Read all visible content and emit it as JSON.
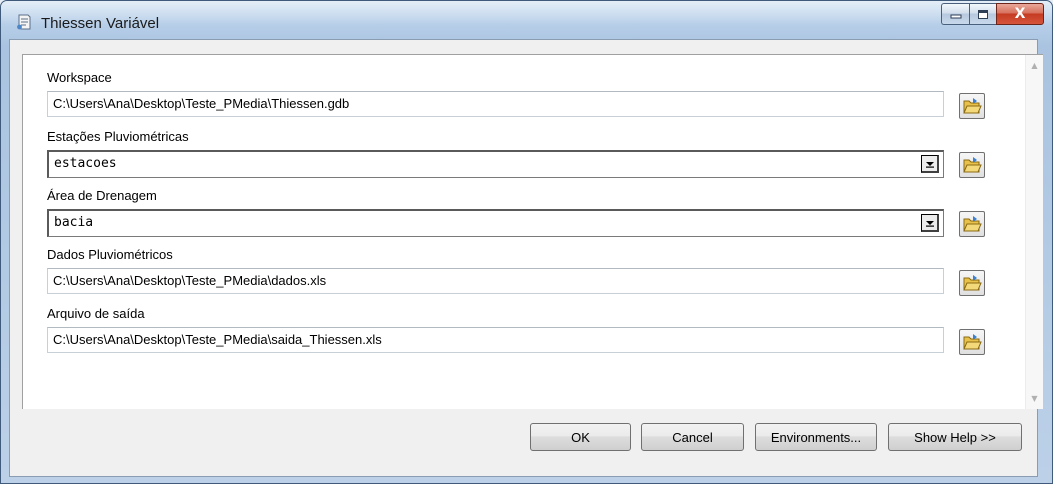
{
  "window": {
    "title": "Thiessen Variável",
    "close_label": "X"
  },
  "fields": {
    "workspace": {
      "label": "Workspace",
      "value": "C:\\Users\\Ana\\Desktop\\Teste_PMedia\\Thiessen.gdb"
    },
    "stations": {
      "label": "Estações Pluviométricas",
      "value": "estacoes"
    },
    "drainage": {
      "label": "Área de Drenagem",
      "value": "bacia"
    },
    "rain_data": {
      "label": "Dados Pluviométricos",
      "value": "C:\\Users\\Ana\\Desktop\\Teste_PMedia\\dados.xls"
    },
    "output": {
      "label": "Arquivo de saída",
      "value": "C:\\Users\\Ana\\Desktop\\Teste_PMedia\\saida_Thiessen.xls"
    }
  },
  "buttons": {
    "ok": "OK",
    "cancel": "Cancel",
    "environments": "Environments...",
    "show_help": "Show Help >>"
  },
  "icons": {
    "title": "tool-script-icon",
    "browse": "folder-open-icon",
    "dropdown": "chevron-down-icon"
  },
  "colors": {
    "title_bar": "#b3cbe6",
    "close_button": "#c43b22",
    "folder_icon": "#e8c14a"
  }
}
